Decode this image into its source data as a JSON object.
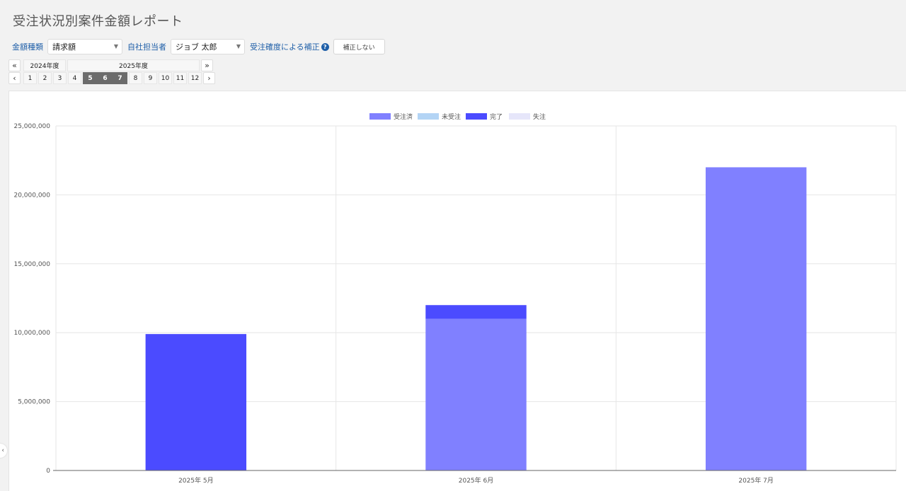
{
  "title": "受注状況別案件金額レポート",
  "filters": {
    "amount_type_label": "金額種類",
    "amount_type_value": "請求額",
    "owner_label": "自社担当者",
    "owner_value": "ジョブ 太郎",
    "correction_label": "受注確度による補正",
    "help_icon": "?",
    "correction_button": "補正しない"
  },
  "period": {
    "prev_year_icon": "«",
    "next_year_icon": "»",
    "prev_month_icon": "‹",
    "next_month_icon": "›",
    "fiscal_years": [
      "2024年度",
      "2025年度"
    ],
    "months": [
      "1",
      "2",
      "3",
      "4",
      "5",
      "6",
      "7",
      "8",
      "9",
      "10",
      "11",
      "12"
    ],
    "selected_months": [
      "5",
      "6",
      "7"
    ]
  },
  "sidebar_toggle_icon": "‹",
  "chart_data": {
    "type": "bar",
    "stacked": true,
    "categories": [
      "2025年 5月",
      "2025年 6月",
      "2025年 7月"
    ],
    "series": [
      {
        "name": "受注済",
        "color": "#8080ff",
        "values": [
          0,
          11000000,
          22000000
        ]
      },
      {
        "name": "未受注",
        "color": "#b3d4f5",
        "values": [
          0,
          0,
          0
        ]
      },
      {
        "name": "完了",
        "color": "#4b4bff",
        "values": [
          9900000,
          1000000,
          0
        ]
      },
      {
        "name": "失注",
        "color": "#e6e6fa",
        "values": [
          0,
          0,
          0
        ]
      }
    ],
    "ylim": [
      0,
      25000000
    ],
    "yticks": [
      0,
      5000000,
      10000000,
      15000000,
      20000000,
      25000000
    ],
    "ytick_labels": [
      "0",
      "5,000,000",
      "10,000,000",
      "15,000,000",
      "20,000,000",
      "25,000,000"
    ],
    "legend": "top",
    "grid": true
  }
}
